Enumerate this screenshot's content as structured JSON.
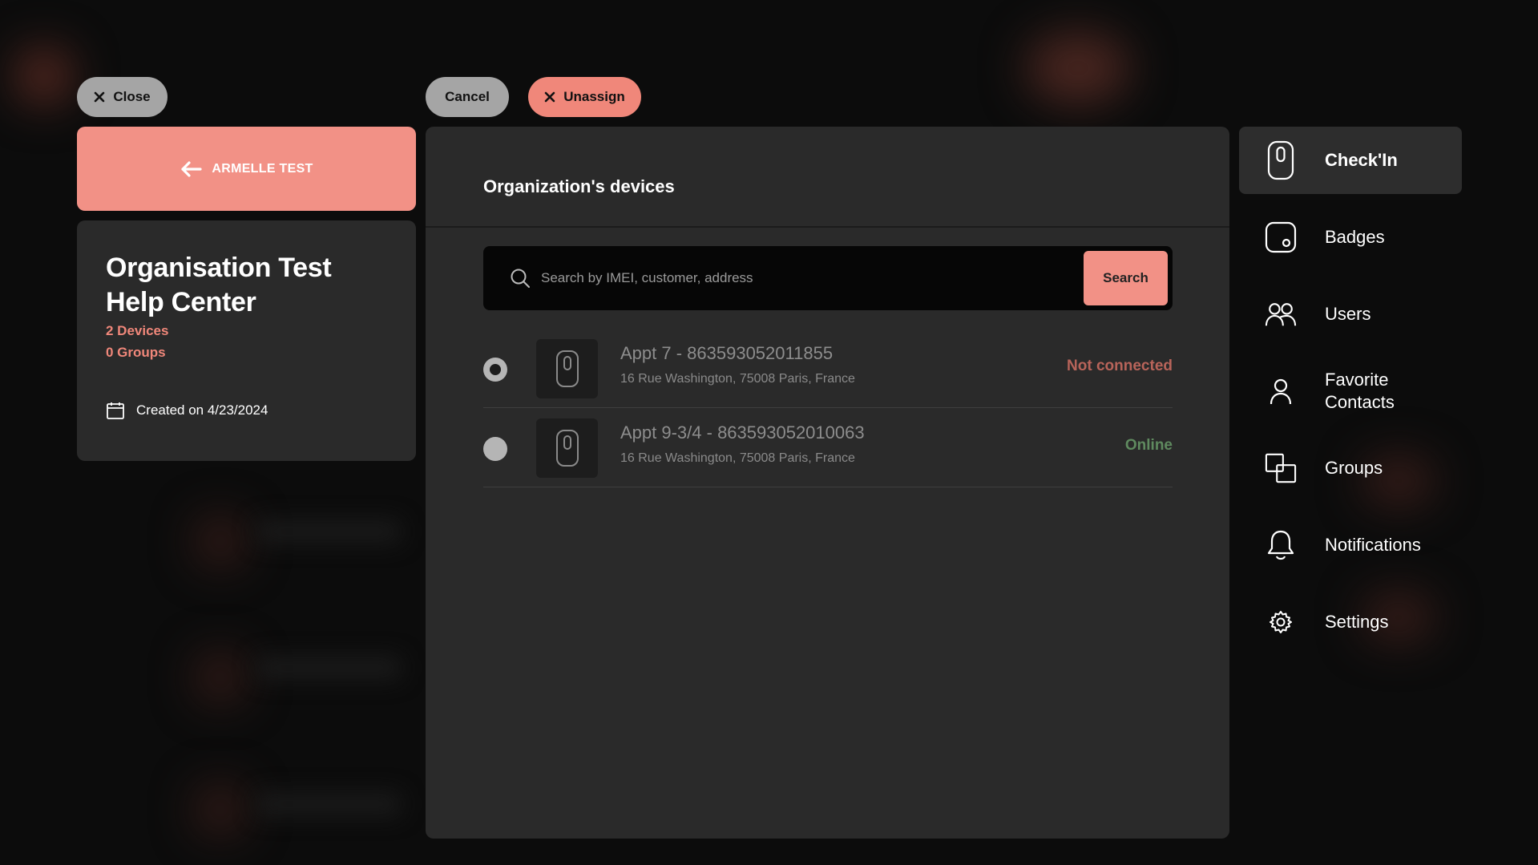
{
  "toolbar": {
    "close_label": "Close",
    "cancel_label": "Cancel",
    "unassign_label": "Unassign"
  },
  "back": {
    "label": "ARMELLE TEST"
  },
  "organization": {
    "name": "Organisation Test Help Center",
    "devices_count": "2 Devices",
    "groups_count": "0 Groups",
    "created": "Created on 4/23/2024"
  },
  "panel": {
    "title": "Organization's devices",
    "search_placeholder": "Search by IMEI, customer, address",
    "search_button": "Search"
  },
  "devices": [
    {
      "name": "Appt 7 - 863593052011855",
      "address": "16 Rue Washington, 75008 Paris, France",
      "status": "Not connected",
      "selected": true
    },
    {
      "name": "Appt 9-3/4 - 863593052010063",
      "address": "16 Rue Washington, 75008 Paris, France",
      "status": "Online",
      "selected": false
    }
  ],
  "nav": {
    "items": [
      {
        "label": "Check'In",
        "icon": "device-icon",
        "active": true
      },
      {
        "label": "Badges",
        "icon": "badge-icon"
      },
      {
        "label": "Users",
        "icon": "users-icon"
      },
      {
        "label": "Favorite Contacts",
        "icon": "contact-icon"
      },
      {
        "label": "Groups",
        "icon": "groups-icon"
      },
      {
        "label": "Notifications",
        "icon": "bell-icon"
      },
      {
        "label": "Settings",
        "icon": "gear-icon"
      }
    ]
  },
  "colors": {
    "accent": "#f29186",
    "panel": "#2a2a2a",
    "background": "#0c0c0c",
    "status_offline": "#b8645a",
    "status_online": "#5f8a5f"
  }
}
